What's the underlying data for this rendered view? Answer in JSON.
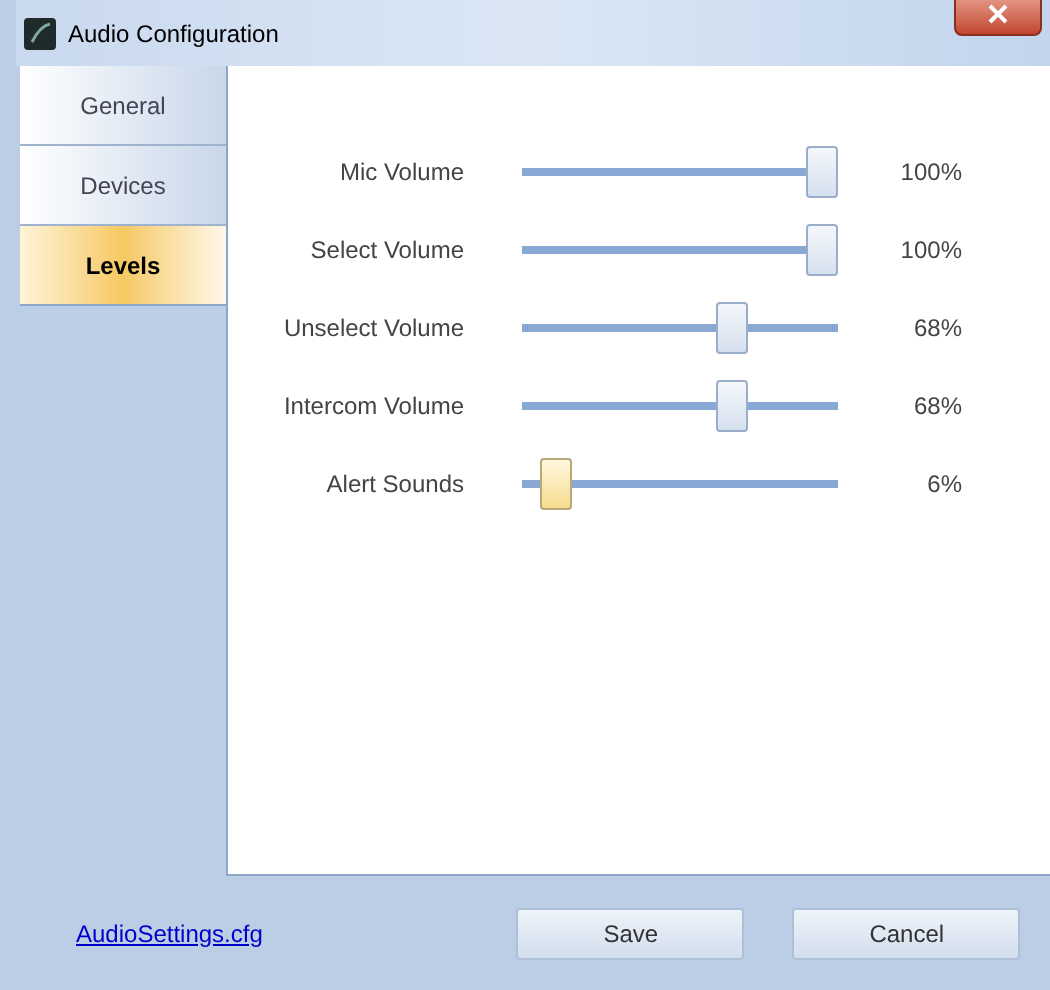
{
  "window": {
    "title": "Audio Configuration"
  },
  "tabs": [
    {
      "label": "General",
      "selected": false
    },
    {
      "label": "Devices",
      "selected": false
    },
    {
      "label": "Levels",
      "selected": true
    }
  ],
  "sliders": [
    {
      "label": "Mic Volume",
      "level": 1,
      "reading": "100%",
      "focused": false
    },
    {
      "label": "Select Volume",
      "level": 1,
      "reading": "100%",
      "focused": false
    },
    {
      "label": "Unselect Volume",
      "level": 0.68,
      "reading": "68%",
      "focused": false
    },
    {
      "label": "Intercom Volume",
      "level": 0.68,
      "reading": "68%",
      "focused": false
    },
    {
      "label": "Alert Sounds",
      "level": 0.06,
      "reading": "6%",
      "focused": true
    }
  ],
  "footer": {
    "link": "AudioSettings.cfg",
    "buttons": [
      "Save",
      "Cancel"
    ]
  }
}
